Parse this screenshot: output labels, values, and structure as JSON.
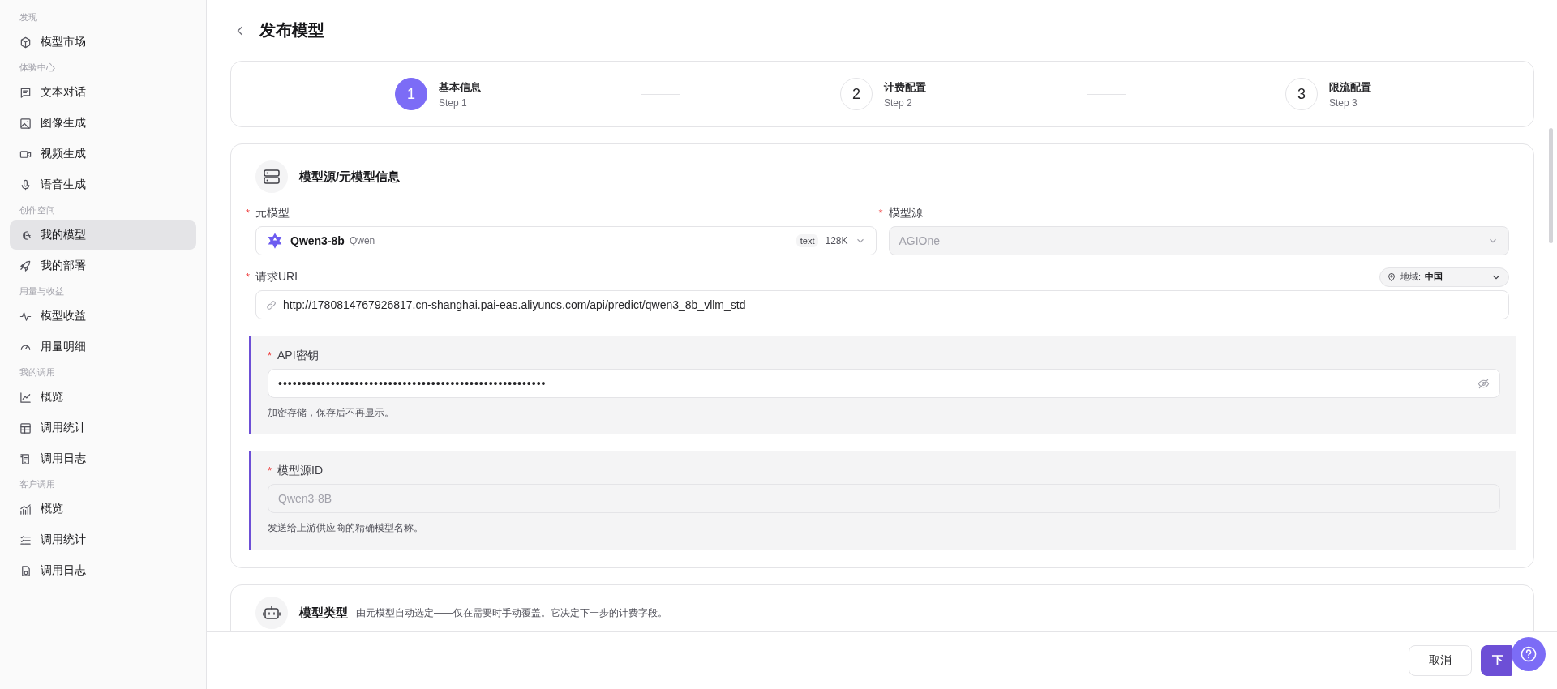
{
  "sidebar": {
    "groups": [
      {
        "label": "发现",
        "items": [
          {
            "label": "模型市场",
            "selected": false
          }
        ]
      },
      {
        "label": "体验中心",
        "items": [
          {
            "label": "文本对话",
            "selected": false
          },
          {
            "label": "图像生成",
            "selected": false
          },
          {
            "label": "视频生成",
            "selected": false
          },
          {
            "label": "语音生成",
            "selected": false
          }
        ]
      },
      {
        "label": "创作空间",
        "items": [
          {
            "label": "我的模型",
            "selected": true
          },
          {
            "label": "我的部署",
            "selected": false
          }
        ]
      },
      {
        "label": "用量与收益",
        "items": [
          {
            "label": "模型收益",
            "selected": false
          },
          {
            "label": "用量明细",
            "selected": false
          }
        ]
      },
      {
        "label": "我的调用",
        "items": [
          {
            "label": "概览",
            "selected": false
          },
          {
            "label": "调用统计",
            "selected": false
          },
          {
            "label": "调用日志",
            "selected": false
          }
        ]
      },
      {
        "label": "客户调用",
        "items": [
          {
            "label": "概览",
            "selected": false
          },
          {
            "label": "调用统计",
            "selected": false
          },
          {
            "label": "调用日志",
            "selected": false
          }
        ]
      }
    ]
  },
  "page": {
    "title": "发布模型"
  },
  "steps": [
    {
      "number": "1",
      "title": "基本信息",
      "subtitle": "Step 1",
      "selected": true
    },
    {
      "number": "2",
      "title": "计费配置",
      "subtitle": "Step 2",
      "selected": false
    },
    {
      "number": "3",
      "title": "限流配置",
      "subtitle": "Step 3",
      "selected": false
    }
  ],
  "source_section": {
    "title": "模型源/元模型信息",
    "meta_model": {
      "required_mark": "*",
      "label": "元模型",
      "name": "Qwen3-8b",
      "vendor": "Qwen",
      "tag": "text",
      "context": "128K"
    },
    "model_source": {
      "required_mark": "*",
      "label": "模型源",
      "value": "AGIOne",
      "disabled": true
    },
    "url": {
      "required_mark": "*",
      "label": "请求URL",
      "value": "http://1780814767926817.cn-shanghai.pai-eas.aliyuncs.com/api/predict/qwen3_8b_vllm_std",
      "region_label": "地域:",
      "region_value": "中国"
    },
    "api_key": {
      "required_mark": "*",
      "label": "API密钥",
      "value": "••••••••••••••••••••••••••••••••••••••••••••••••••••••••",
      "hint": "加密存储，保存后不再显示。"
    },
    "source_id": {
      "required_mark": "*",
      "label": "模型源ID",
      "placeholder": "Qwen3-8B",
      "hint": "发送给上游供应商的精确模型名称。"
    }
  },
  "type_section": {
    "title": "模型类型",
    "description": "由元模型自动选定——仅在需要时手动覆盖。它决定下一步的计费字段。"
  },
  "footer": {
    "cancel": "取消",
    "next": "下"
  }
}
